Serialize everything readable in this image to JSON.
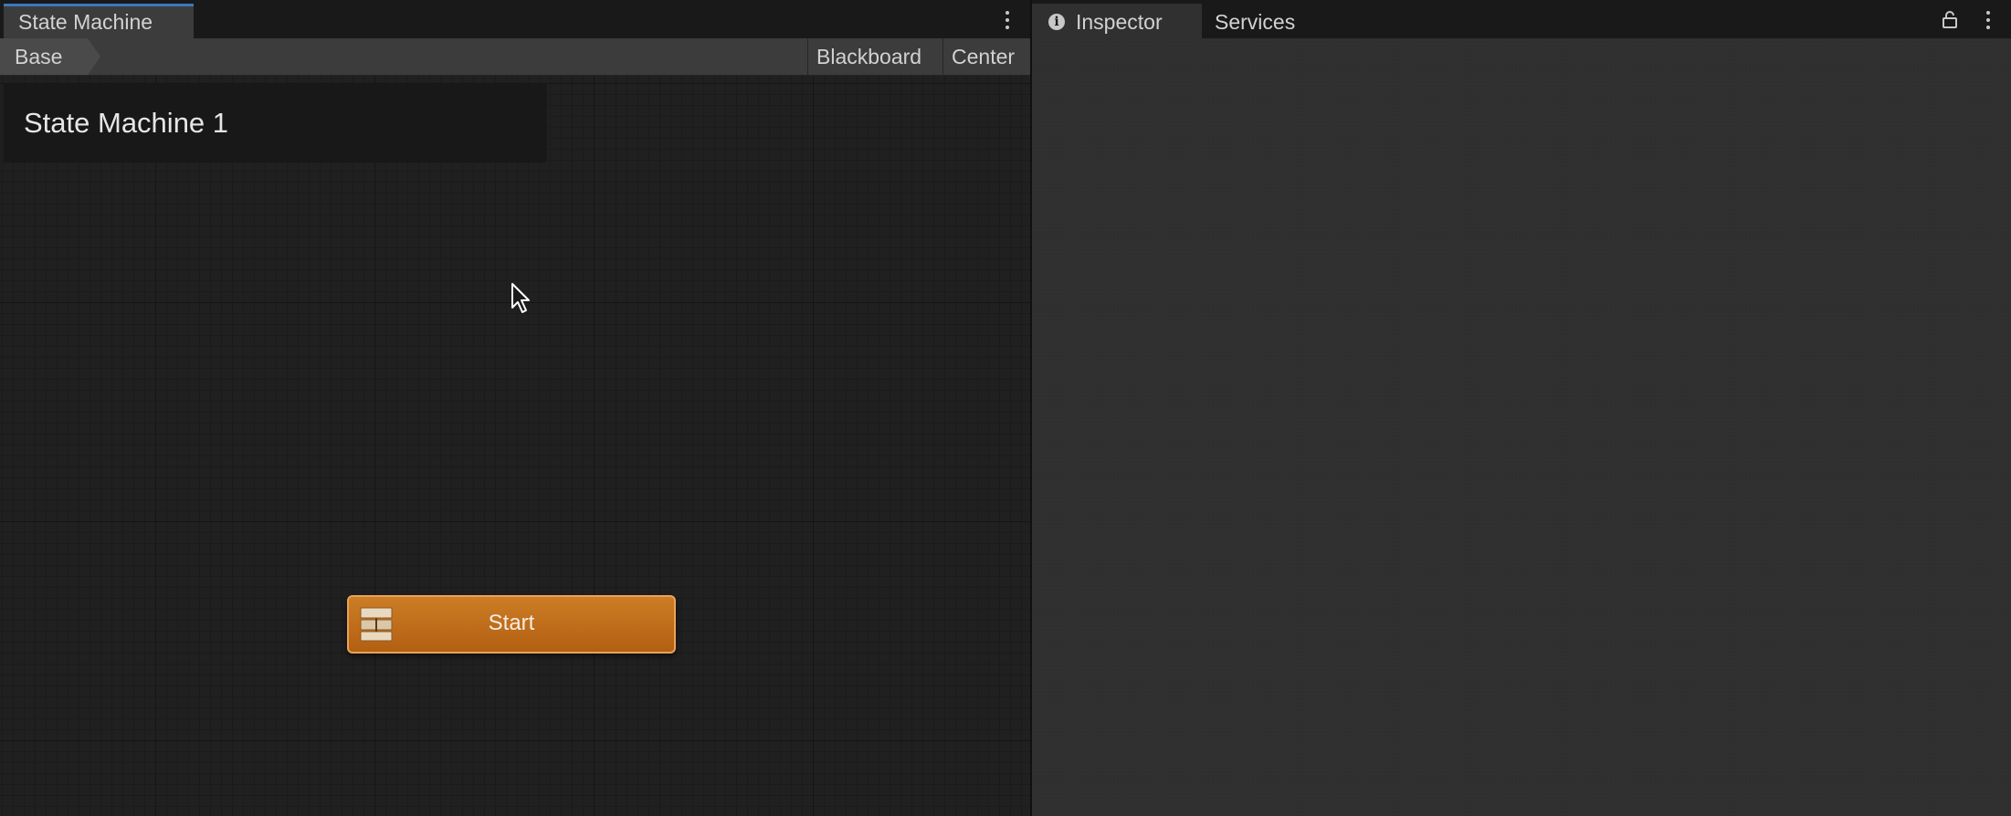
{
  "state_machine_window": {
    "tab_title": "State Machine",
    "breadcrumb": "Base",
    "toolbar": {
      "blackboard_label": "Blackboard",
      "center_label": "Center"
    },
    "graph_title": "State Machine 1",
    "nodes": [
      {
        "label": "Start",
        "type": "entry",
        "color": "#c26d1d"
      }
    ]
  },
  "right_window": {
    "tabs": [
      {
        "label": "Inspector",
        "icon": "info-icon",
        "active": true
      },
      {
        "label": "Services",
        "active": false
      }
    ]
  },
  "colors": {
    "accent": "#3a79bb",
    "start_node": "#c26d1d",
    "panel_bg": "#202020"
  }
}
